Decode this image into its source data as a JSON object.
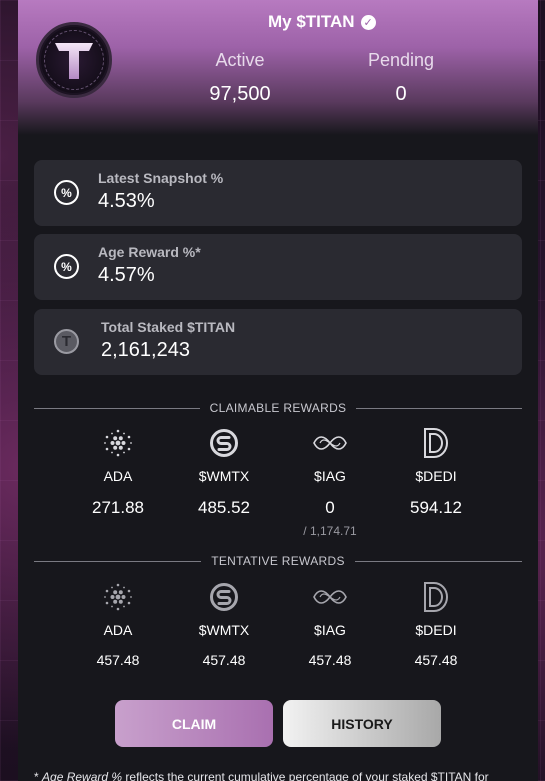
{
  "header": {
    "title": "My $TITAN",
    "active_label": "Active",
    "active_value": "97,500",
    "pending_label": "Pending",
    "pending_value": "0",
    "logo_letter": "T"
  },
  "cards": {
    "snapshot": {
      "label": "Latest Snapshot %",
      "value": "4.53%",
      "icon": "percent-icon"
    },
    "age": {
      "label": "Age Reward %*",
      "value": "4.57%",
      "icon": "percent-icon"
    },
    "staked": {
      "label": "Total Staked $TITAN",
      "value": "2,161,243",
      "icon": "titan-token-icon"
    }
  },
  "claimable": {
    "heading": "CLAIMABLE REWARDS",
    "items": [
      {
        "name": "ADA",
        "value": "271.88",
        "icon": "ada-icon"
      },
      {
        "name": "$WMTX",
        "value": "485.52",
        "icon": "wmtx-icon"
      },
      {
        "name": "$IAG",
        "value": "0",
        "sub": "/ 1,174.71",
        "icon": "iag-icon"
      },
      {
        "name": "$DEDI",
        "value": "594.12",
        "icon": "dedi-icon"
      }
    ]
  },
  "tentative": {
    "heading": "TENTATIVE REWARDS",
    "items": [
      {
        "name": "ADA",
        "value": "457.48",
        "icon": "ada-icon"
      },
      {
        "name": "$WMTX",
        "value": "457.48",
        "icon": "wmtx-icon"
      },
      {
        "name": "$IAG",
        "value": "457.48",
        "icon": "iag-icon"
      },
      {
        "name": "$DEDI",
        "value": "457.48",
        "icon": "dedi-icon"
      }
    ]
  },
  "buttons": {
    "claim": "CLAIM",
    "history": "HISTORY"
  },
  "footnote": {
    "prefix": "* ",
    "emph": "Age Reward %",
    "text": " reflects the current cumulative percentage of your staked $TITAN for"
  },
  "colors": {
    "accent": "#a970b0",
    "panel": "#17171c",
    "card": "#2a2a31"
  }
}
